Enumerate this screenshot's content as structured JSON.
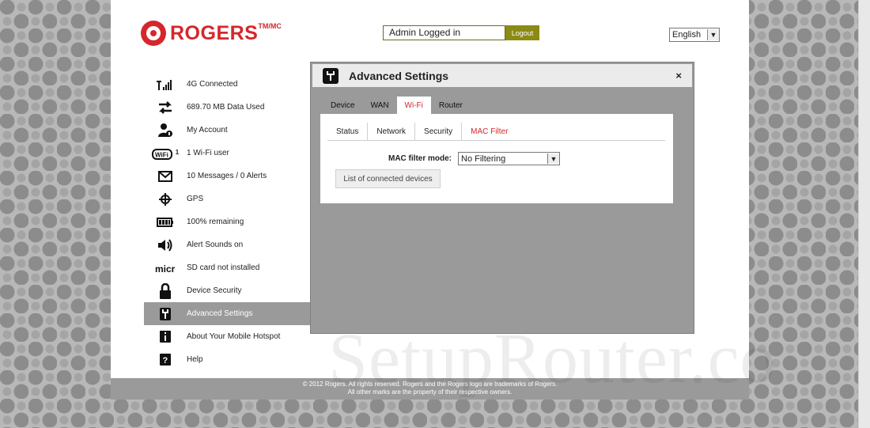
{
  "brand": {
    "name": "ROGERS",
    "tm": "TM/MC"
  },
  "header": {
    "admin_status": "Admin Logged in",
    "logout_label": "Logout",
    "language": "English"
  },
  "sidebar": {
    "items": [
      {
        "label": "4G Connected",
        "icon": "signal-icon"
      },
      {
        "label": "689.70 MB Data Used",
        "icon": "data-transfer-icon"
      },
      {
        "label": "My Account",
        "icon": "account-icon"
      },
      {
        "label": "1 Wi-Fi user",
        "icon": "wifi-icon",
        "badge": "1"
      },
      {
        "label": "10 Messages / 0 Alerts",
        "icon": "envelope-icon"
      },
      {
        "label": "GPS",
        "icon": "gps-icon"
      },
      {
        "label": "100% remaining",
        "icon": "battery-icon"
      },
      {
        "label": "Alert Sounds on",
        "icon": "speaker-icon"
      },
      {
        "label": "SD card not installed",
        "icon": "sd-card-icon"
      },
      {
        "label": "Device Security",
        "icon": "lock-icon"
      },
      {
        "label": "Advanced Settings",
        "icon": "wrench-icon",
        "active": true
      },
      {
        "label": "About Your Mobile Hotspot",
        "icon": "info-icon"
      },
      {
        "label": "Help",
        "icon": "help-icon"
      }
    ]
  },
  "modal": {
    "title": "Advanced Settings",
    "close": "×",
    "tabs": [
      "Device",
      "WAN",
      "Wi-Fi",
      "Router"
    ],
    "active_tab": "Wi-Fi",
    "subtabs": [
      "Status",
      "Network",
      "Security",
      "MAC Filter"
    ],
    "active_subtab": "MAC Filter",
    "mac_filter_label": "MAC filter mode:",
    "mac_filter_value": "No Filtering",
    "list_button": "List of connected devices"
  },
  "footer": {
    "line1": "© 2012 Rogers. All rights reserved. Rogers and the Rogers logo are trademarks of Rogers.",
    "line2": "All other marks are the property of their respective owners."
  },
  "watermark": "SetupRouter.co",
  "colors": {
    "brand_red": "#d6262c",
    "logout_olive": "#8a8a14",
    "active_gray": "#9a9a9a"
  }
}
